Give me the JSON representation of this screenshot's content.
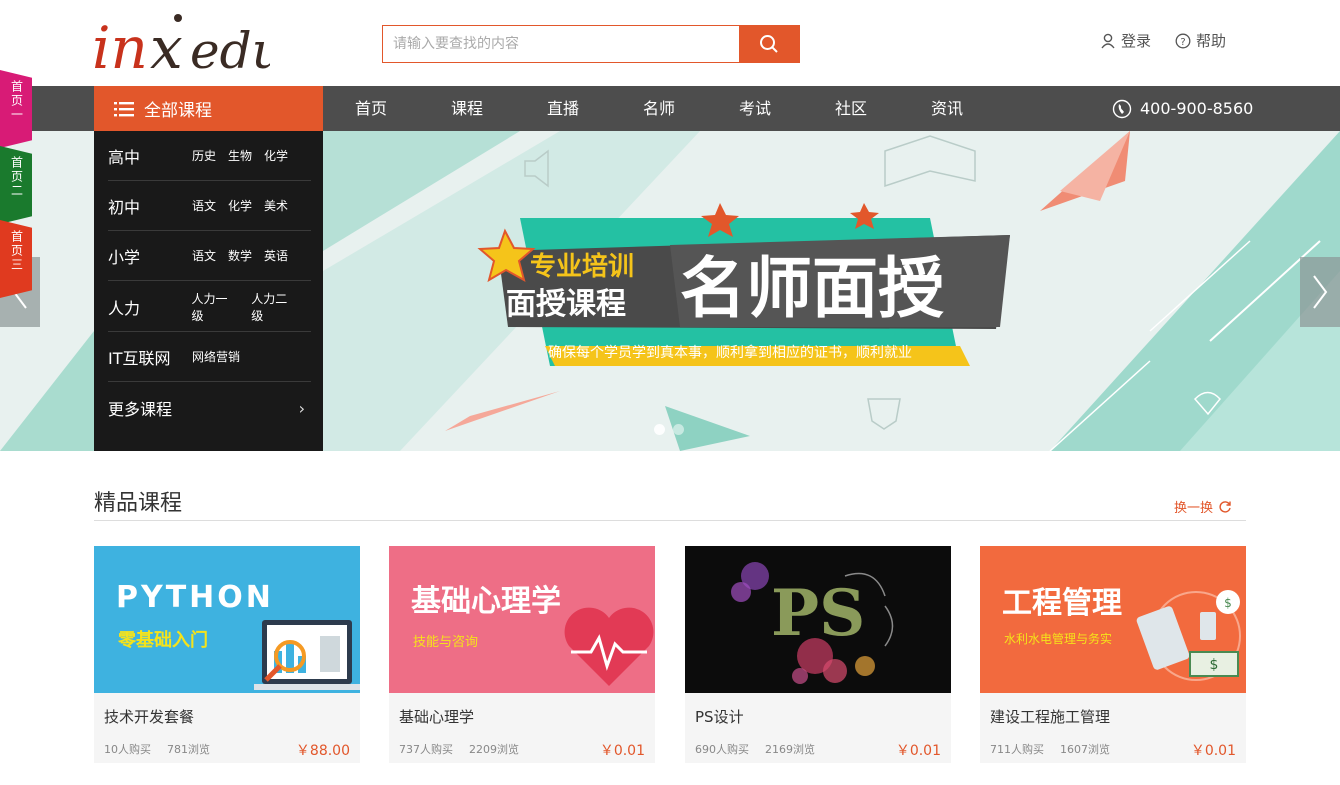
{
  "header": {
    "logo_text": "inxedu",
    "search_placeholder": "请输入要查找的内容",
    "login": "登录",
    "help": "帮助"
  },
  "nav": {
    "all_courses": "全部课程",
    "items": [
      "首页",
      "课程",
      "直播",
      "名师",
      "考试",
      "社区",
      "资讯"
    ],
    "phone": "400-900-8560"
  },
  "side_tabs": [
    "首页一",
    "首页二",
    "首页三"
  ],
  "categories": [
    {
      "name": "高中",
      "subs": [
        "历史",
        "生物",
        "化学"
      ]
    },
    {
      "name": "初中",
      "subs": [
        "语文",
        "化学",
        "美术"
      ]
    },
    {
      "name": "小学",
      "subs": [
        "语文",
        "数学",
        "英语"
      ]
    },
    {
      "name": "人力",
      "subs": [
        "人力一级",
        "人力二级"
      ]
    },
    {
      "name": "IT互联网",
      "subs": [
        "网络营销"
      ]
    },
    {
      "name": "更多课程",
      "subs": []
    }
  ],
  "banner": {
    "tag_line1": "专业培训",
    "tag_line2": "面授课程",
    "headline": "名师面授",
    "subtitle": "确保每个学员学到真本事，顺利拿到相应的证书，顺利就业"
  },
  "featured": {
    "title": "精品课程",
    "refresh": "换一换",
    "courses": [
      {
        "title": "技术开发套餐",
        "buyers": "10人购买",
        "views": "781浏览",
        "price": "￥88.00",
        "thumb_title": "PYTHON",
        "thumb_sub": "零基础入门",
        "bg": "#3eb2e0"
      },
      {
        "title": "基础心理学",
        "buyers": "737人购买",
        "views": "2209浏览",
        "price": "￥0.01",
        "thumb_title": "基础心理学",
        "thumb_sub": "技能与咨询",
        "bg": "#ee6e86"
      },
      {
        "title": "PS设计",
        "buyers": "690人购买",
        "views": "2169浏览",
        "price": "￥0.01",
        "thumb_title": "PS",
        "thumb_sub": "",
        "bg": "#0c0c0c"
      },
      {
        "title": "建设工程施工管理",
        "buyers": "711人购买",
        "views": "1607浏览",
        "price": "￥0.01",
        "thumb_title": "工程管理",
        "thumb_sub": "水利水电管理与务实",
        "bg": "#f26a3e"
      }
    ]
  },
  "colors": {
    "accent": "#e2572b",
    "nav_bg": "#4d4d4d",
    "menu_bg": "#191919"
  }
}
